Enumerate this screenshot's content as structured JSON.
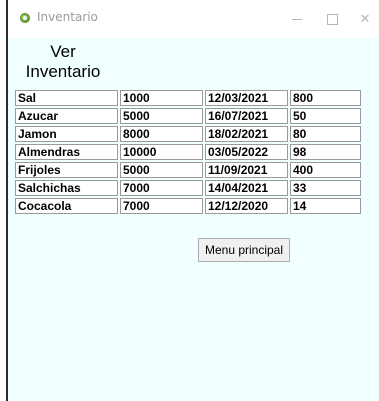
{
  "window": {
    "title": "Inventario",
    "icon": "app-icon"
  },
  "heading": {
    "line1": "Ver",
    "line2": "Inventario"
  },
  "inventory": {
    "rows": [
      [
        "Sal",
        "1000",
        "12/03/2021",
        "800"
      ],
      [
        "Azucar",
        "5000",
        "16/07/2021",
        "50"
      ],
      [
        "Jamon",
        "8000",
        "18/02/2021",
        "80"
      ],
      [
        "Almendras",
        "10000",
        "03/05/2022",
        "98"
      ],
      [
        "Frijoles",
        "5000",
        "11/09/2021",
        "400"
      ],
      [
        "Salchichas",
        "7000",
        "14/04/2021",
        "33"
      ],
      [
        "Cocacola",
        "7000",
        "12/12/2020",
        "14"
      ]
    ]
  },
  "actions": {
    "menu_button_label": "Menu principal"
  },
  "colors": {
    "window_background": "#f0ffff",
    "cell_background": "#ffffff",
    "cell_border": "#9a9a9a"
  }
}
